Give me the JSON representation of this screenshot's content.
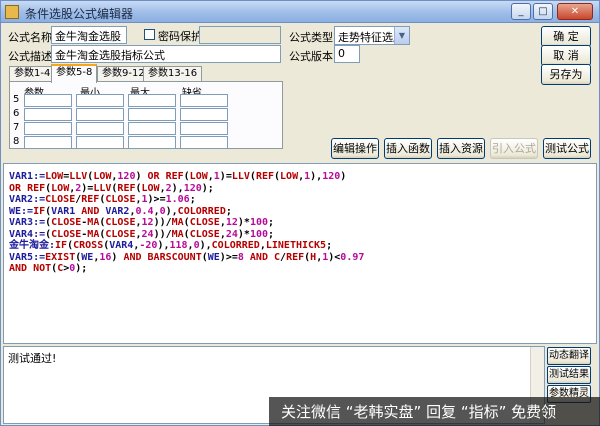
{
  "window": {
    "title": "条件选股公式编辑器",
    "buttons": {
      "minimize": "_",
      "maximize": "□",
      "close": "✕"
    }
  },
  "form": {
    "name_label": "公式名称",
    "name_value": "金牛淘金选股",
    "password_label": "密码保护",
    "password_checked": false,
    "password_value": "",
    "type_label": "公式类型",
    "type_value": "走势特征选股",
    "desc_label": "公式描述",
    "desc_value": "金牛淘金选股指标公式",
    "version_label": "公式版本",
    "version_value": "0"
  },
  "side_buttons": {
    "ok": "确  定",
    "cancel": "取  消",
    "save_as": "另存为"
  },
  "tabs": [
    "参数1-4",
    "参数5-8",
    "参数9-12",
    "参数13-16"
  ],
  "active_tab": 1,
  "param_table": {
    "headers": [
      "参数",
      "最小",
      "最大",
      "缺省"
    ],
    "rows": [
      "5",
      "6",
      "7",
      "8"
    ]
  },
  "toolbar": {
    "edit_ops": "编辑操作",
    "insert_func": "插入函数",
    "insert_resource": "插入资源",
    "import_formula": "引入公式",
    "test_formula": "测试公式"
  },
  "code_lines": [
    [
      [
        "VAR1:=",
        "i"
      ],
      [
        "LOW",
        "f"
      ],
      [
        "=",
        "o"
      ],
      [
        "LLV",
        "f"
      ],
      [
        "(",
        "o"
      ],
      [
        "LOW",
        "f"
      ],
      [
        ",",
        "o"
      ],
      [
        "120",
        "n"
      ],
      [
        ") ",
        "o"
      ],
      [
        "OR ",
        "f"
      ],
      [
        "REF",
        "f"
      ],
      [
        "(",
        "o"
      ],
      [
        "LOW",
        "f"
      ],
      [
        ",",
        "o"
      ],
      [
        "1",
        "n"
      ],
      [
        ")=",
        "o"
      ],
      [
        "LLV",
        "f"
      ],
      [
        "(",
        "o"
      ],
      [
        "REF",
        "f"
      ],
      [
        "(",
        "o"
      ],
      [
        "LOW",
        "f"
      ],
      [
        ",",
        "o"
      ],
      [
        "1",
        "n"
      ],
      [
        "),",
        "o"
      ],
      [
        "120",
        "n"
      ],
      [
        ")",
        "o"
      ]
    ],
    [
      [
        "OR ",
        "f"
      ],
      [
        "REF",
        "f"
      ],
      [
        "(",
        "o"
      ],
      [
        "LOW",
        "f"
      ],
      [
        ",",
        "o"
      ],
      [
        "2",
        "n"
      ],
      [
        ")=",
        "o"
      ],
      [
        "LLV",
        "f"
      ],
      [
        "(",
        "o"
      ],
      [
        "REF",
        "f"
      ],
      [
        "(",
        "o"
      ],
      [
        "LOW",
        "f"
      ],
      [
        ",",
        "o"
      ],
      [
        "2",
        "n"
      ],
      [
        "),",
        "o"
      ],
      [
        "120",
        "n"
      ],
      [
        ");",
        "o"
      ]
    ],
    [
      [
        "VAR2:=",
        "i"
      ],
      [
        "CLOSE",
        "f"
      ],
      [
        "/",
        "o"
      ],
      [
        "REF",
        "f"
      ],
      [
        "(",
        "o"
      ],
      [
        "CLOSE",
        "f"
      ],
      [
        ",",
        "o"
      ],
      [
        "1",
        "n"
      ],
      [
        ")>=",
        "o"
      ],
      [
        "1.06",
        "n"
      ],
      [
        ";",
        "o"
      ]
    ],
    [
      [
        "WE:=",
        "i"
      ],
      [
        "IF",
        "f"
      ],
      [
        "(",
        "o"
      ],
      [
        "VAR1 ",
        "i"
      ],
      [
        "AND ",
        "f"
      ],
      [
        "VAR2",
        "i"
      ],
      [
        ",",
        "o"
      ],
      [
        "0.4",
        "n"
      ],
      [
        ",",
        "o"
      ],
      [
        "0",
        "n"
      ],
      [
        "),",
        "o"
      ],
      [
        "COLORRED",
        "f"
      ],
      [
        ";",
        "o"
      ]
    ],
    [
      [
        "VAR3:=",
        "i"
      ],
      [
        "(",
        "o"
      ],
      [
        "CLOSE",
        "f"
      ],
      [
        "-",
        "o"
      ],
      [
        "MA",
        "f"
      ],
      [
        "(",
        "o"
      ],
      [
        "CLOSE",
        "f"
      ],
      [
        ",",
        "o"
      ],
      [
        "12",
        "n"
      ],
      [
        "))/",
        "o"
      ],
      [
        "MA",
        "f"
      ],
      [
        "(",
        "o"
      ],
      [
        "CLOSE",
        "f"
      ],
      [
        ",",
        "o"
      ],
      [
        "12",
        "n"
      ],
      [
        ")*",
        "o"
      ],
      [
        "100",
        "n"
      ],
      [
        ";",
        "o"
      ]
    ],
    [
      [
        "VAR4:=",
        "i"
      ],
      [
        "(",
        "o"
      ],
      [
        "CLOSE",
        "f"
      ],
      [
        "-",
        "o"
      ],
      [
        "MA",
        "f"
      ],
      [
        "(",
        "o"
      ],
      [
        "CLOSE",
        "f"
      ],
      [
        ",",
        "o"
      ],
      [
        "24",
        "n"
      ],
      [
        "))/",
        "o"
      ],
      [
        "MA",
        "f"
      ],
      [
        "(",
        "o"
      ],
      [
        "CLOSE",
        "f"
      ],
      [
        ",",
        "o"
      ],
      [
        "24",
        "n"
      ],
      [
        ")*",
        "o"
      ],
      [
        "100",
        "n"
      ],
      [
        ";",
        "o"
      ]
    ],
    [
      [
        "金牛淘金:",
        "i"
      ],
      [
        "IF",
        "f"
      ],
      [
        "(",
        "o"
      ],
      [
        "CROSS",
        "f"
      ],
      [
        "(",
        "o"
      ],
      [
        "VAR4",
        "i"
      ],
      [
        ",",
        "o"
      ],
      [
        "-20",
        "n"
      ],
      [
        "),",
        "o"
      ],
      [
        "118",
        "n"
      ],
      [
        ",",
        "o"
      ],
      [
        "0",
        "n"
      ],
      [
        "),",
        "o"
      ],
      [
        "COLORRED",
        "f"
      ],
      [
        ",",
        "o"
      ],
      [
        "LINETHICK5",
        "f"
      ],
      [
        ";",
        "o"
      ]
    ],
    [
      [
        "VAR5:=",
        "i"
      ],
      [
        "EXIST",
        "f"
      ],
      [
        "(",
        "o"
      ],
      [
        "WE",
        "i"
      ],
      [
        ",",
        "o"
      ],
      [
        "16",
        "n"
      ],
      [
        ") ",
        "o"
      ],
      [
        "AND ",
        "f"
      ],
      [
        "BARSCOUNT",
        "f"
      ],
      [
        "(",
        "o"
      ],
      [
        "WE",
        "i"
      ],
      [
        ")>=",
        "o"
      ],
      [
        "8",
        "n"
      ],
      [
        " AND ",
        "f"
      ],
      [
        "C",
        "f"
      ],
      [
        "/",
        "o"
      ],
      [
        "REF",
        "f"
      ],
      [
        "(",
        "o"
      ],
      [
        "H",
        "f"
      ],
      [
        ",",
        "o"
      ],
      [
        "1",
        "n"
      ],
      [
        ")<",
        "o"
      ],
      [
        "0.97",
        "n"
      ]
    ],
    [
      [
        "AND ",
        "f"
      ],
      [
        "NOT",
        "f"
      ],
      [
        "(",
        "o"
      ],
      [
        "C",
        "f"
      ],
      [
        ">",
        "o"
      ],
      [
        "0",
        "n"
      ],
      [
        ");",
        "o"
      ]
    ]
  ],
  "result": {
    "text": "测试通过!"
  },
  "result_buttons": [
    "动态翻译",
    "测试结果",
    "参数精灵"
  ],
  "watermark": "关注微信 “老韩实盘” 回复 “指标” 免费领",
  "colors": {
    "identifier": "#1d1b9c",
    "function": "#b40000",
    "number": "#b70a9a",
    "operator": "#000000",
    "watermark_bg": "#141414"
  },
  "icons": {
    "app": "app-icon",
    "dropdown": "chevron-down-icon"
  }
}
